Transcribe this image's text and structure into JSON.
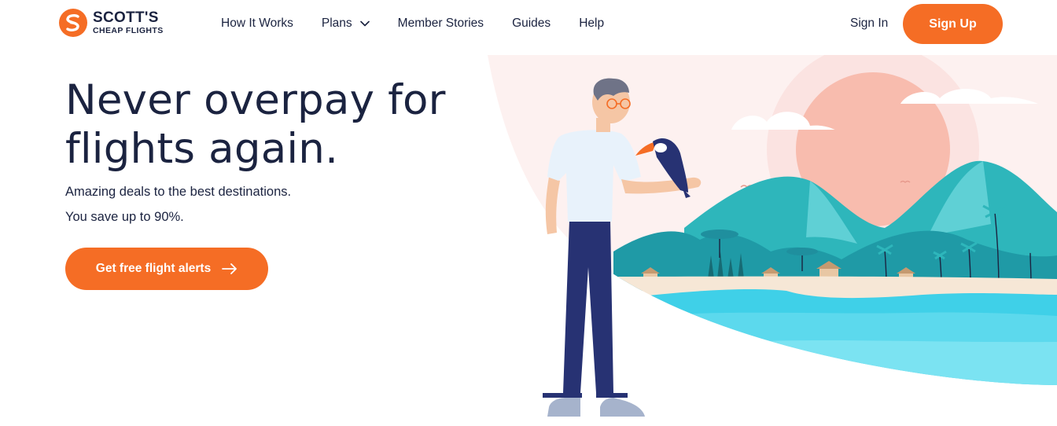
{
  "brand": {
    "name": "SCOTT'S",
    "tagline": "CHEAP FLIGHTS",
    "accent_color": "#f56d25",
    "text_color": "#1b2340"
  },
  "nav": {
    "items": [
      {
        "label": "How It Works"
      },
      {
        "label": "Plans",
        "has_dropdown": true
      },
      {
        "label": "Member Stories"
      },
      {
        "label": "Guides"
      },
      {
        "label": "Help"
      }
    ],
    "sign_in": "Sign In",
    "sign_up": "Sign Up"
  },
  "hero": {
    "headline": "Never overpay for flights again.",
    "subtitle_1": "Amazing deals to the best destinations.",
    "subtitle_2": "You save up to 90%.",
    "cta_label": "Get free flight alerts",
    "cta_icon": "arrow-right-icon"
  },
  "illustration": {
    "subject": "man-with-toucan-tropical-beach",
    "colors": {
      "sky": "#fdeeed",
      "sun": "#f9b9a8",
      "mountain": "#2bb3b7",
      "mountain_dark": "#1f8f9e",
      "sand": "#f6e7d6",
      "sea": "#3fd0e8",
      "pants": "#273273",
      "shirt": "#e8f2fb"
    }
  }
}
